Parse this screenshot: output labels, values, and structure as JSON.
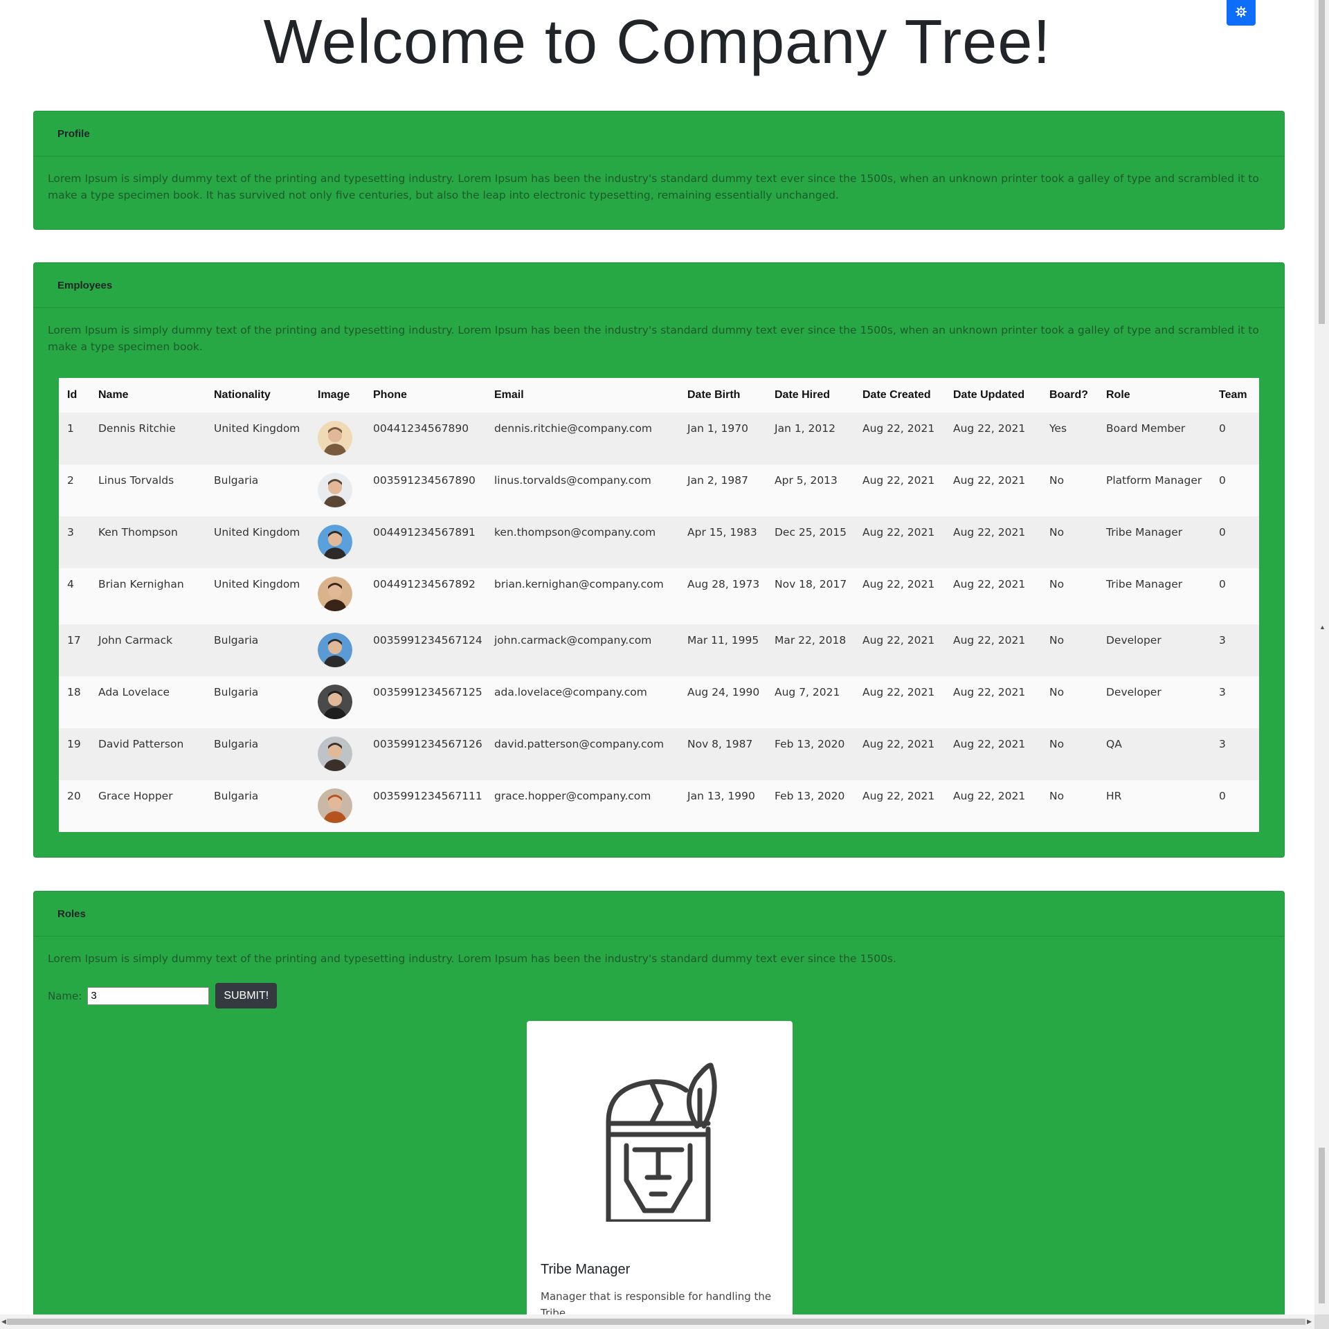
{
  "page": {
    "title": "Welcome to Company Tree!"
  },
  "theme_toggle": {
    "icon": "gear-icon",
    "color": "#0d6efd"
  },
  "colors": {
    "card_bg": "#28a745",
    "dark_button": "#343a40"
  },
  "profile": {
    "title": "Profile",
    "text": "Lorem Ipsum is simply dummy text of the printing and typesetting industry. Lorem Ipsum has been the industry's standard dummy text ever since the 1500s, when an unknown printer took a galley of type and scrambled it to make a type specimen book. It has survived not only five centuries, but also the leap into electronic typesetting, remaining essentially unchanged."
  },
  "employees": {
    "title": "Employees",
    "text": "Lorem Ipsum is simply dummy text of the printing and typesetting industry. Lorem Ipsum has been the industry's standard dummy text ever since the 1500s, when an unknown printer took a galley of type and scrambled it to make a type specimen book.",
    "columns": [
      "Id",
      "Name",
      "Nationality",
      "Image",
      "Phone",
      "Email",
      "Date Birth",
      "Date Hired",
      "Date Created",
      "Date Updated",
      "Board?",
      "Role",
      "Team"
    ],
    "rows": [
      {
        "id": "1",
        "name": "Dennis Ritchie",
        "nationality": "United Kingdom",
        "phone": "00441234567890",
        "email": "dennis.ritchie@company.com",
        "date_birth": "Jan 1, 1970",
        "date_hired": "Jan 1, 2012",
        "date_created": "Aug 22, 2021",
        "date_updated": "Aug 22, 2021",
        "board": "Yes",
        "role": "Board Member",
        "team": "0"
      },
      {
        "id": "2",
        "name": "Linus Torvalds",
        "nationality": "Bulgaria",
        "phone": "003591234567890",
        "email": "linus.torvalds@company.com",
        "date_birth": "Jan 2, 1987",
        "date_hired": "Apr 5, 2013",
        "date_created": "Aug 22, 2021",
        "date_updated": "Aug 22, 2021",
        "board": "No",
        "role": "Platform Manager",
        "team": "0"
      },
      {
        "id": "3",
        "name": "Ken Thompson",
        "nationality": "United Kingdom",
        "phone": "004491234567891",
        "email": "ken.thompson@company.com",
        "date_birth": "Apr 15, 1983",
        "date_hired": "Dec 25, 2015",
        "date_created": "Aug 22, 2021",
        "date_updated": "Aug 22, 2021",
        "board": "No",
        "role": "Tribe Manager",
        "team": "0"
      },
      {
        "id": "4",
        "name": "Brian Kernighan",
        "nationality": "United Kingdom",
        "phone": "004491234567892",
        "email": "brian.kernighan@company.com",
        "date_birth": "Aug 28, 1973",
        "date_hired": "Nov 18, 2017",
        "date_created": "Aug 22, 2021",
        "date_updated": "Aug 22, 2021",
        "board": "No",
        "role": "Tribe Manager",
        "team": "0"
      },
      {
        "id": "17",
        "name": "John Carmack",
        "nationality": "Bulgaria",
        "phone": "0035991234567124",
        "email": "john.carmack@company.com",
        "date_birth": "Mar 11, 1995",
        "date_hired": "Mar 22, 2018",
        "date_created": "Aug 22, 2021",
        "date_updated": "Aug 22, 2021",
        "board": "No",
        "role": "Developer",
        "team": "3"
      },
      {
        "id": "18",
        "name": "Ada Lovelace",
        "nationality": "Bulgaria",
        "phone": "0035991234567125",
        "email": "ada.lovelace@company.com",
        "date_birth": "Aug 24, 1990",
        "date_hired": "Aug 7, 2021",
        "date_created": "Aug 22, 2021",
        "date_updated": "Aug 22, 2021",
        "board": "No",
        "role": "Developer",
        "team": "3"
      },
      {
        "id": "19",
        "name": "David Patterson",
        "nationality": "Bulgaria",
        "phone": "0035991234567126",
        "email": "david.patterson@company.com",
        "date_birth": "Nov 8, 1987",
        "date_hired": "Feb 13, 2020",
        "date_created": "Aug 22, 2021",
        "date_updated": "Aug 22, 2021",
        "board": "No",
        "role": "QA",
        "team": "3"
      },
      {
        "id": "20",
        "name": "Grace Hopper",
        "nationality": "Bulgaria",
        "phone": "0035991234567111",
        "email": "grace.hopper@company.com",
        "date_birth": "Jan 13, 1990",
        "date_hired": "Feb 13, 2020",
        "date_created": "Aug 22, 2021",
        "date_updated": "Aug 22, 2021",
        "board": "No",
        "role": "HR",
        "team": "0"
      }
    ]
  },
  "roles": {
    "title": "Roles",
    "text": "Lorem Ipsum is simply dummy text of the printing and typesetting industry. Lorem Ipsum has been the industry's standard dummy text ever since the 1500s.",
    "form": {
      "label": "Name:",
      "value": "3",
      "submit_label": "SUBMIT!"
    },
    "card": {
      "icon": "tribe-manager-helmet-icon",
      "title": "Tribe Manager",
      "description": "Manager that is responsible for handling the Tribe."
    }
  }
}
